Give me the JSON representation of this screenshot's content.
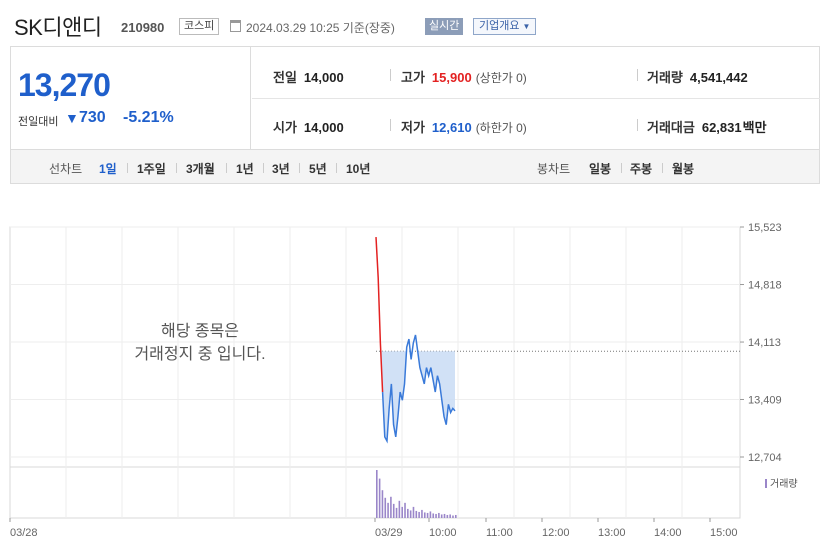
{
  "header": {
    "stock_name": "SK디앤디",
    "stock_code": "210980",
    "market": "코스피",
    "datetime": "2024.03.29 10:25 기준(장중)",
    "realtime_label": "실시간",
    "company_button": "기업개요"
  },
  "price": {
    "current": "13,270",
    "change_label": "전일대비",
    "change_arrow": "▼",
    "change_abs": "730",
    "change_pct": "-5.21%"
  },
  "stats": {
    "prev_close": {
      "label": "전일",
      "value": "14,000"
    },
    "open": {
      "label": "시가",
      "value": "14,000"
    },
    "high": {
      "label": "고가",
      "value": "15,900",
      "sub": "(상한가 0)"
    },
    "low": {
      "label": "저가",
      "value": "12,610",
      "sub": "(하한가 0)"
    },
    "volume": {
      "label": "거래량",
      "value": "4,541,442"
    },
    "trade_value": {
      "label": "거래대금",
      "value": "62,831",
      "unit": "백만"
    }
  },
  "period_bar": {
    "line_label": "선차트",
    "periods": [
      "1일",
      "1주일",
      "3개월",
      "1년",
      "3년",
      "5년",
      "10년"
    ],
    "active_period": "1일",
    "candle_label": "봉차트",
    "candles": [
      "일봉",
      "주봉",
      "월봉"
    ]
  },
  "notice": {
    "line1": "해당 종목은",
    "line2": "거래정지 중 입니다."
  },
  "colors": {
    "up": "#e32222",
    "down": "#1f5fcb",
    "price_line": "#3a7ad9",
    "area_fill": "#c9dcf5",
    "volume": "#9a86c9"
  },
  "chart_data": {
    "type": "line",
    "title": "",
    "xlabel": "",
    "ylabel": "",
    "ylim": [
      12704,
      15523
    ],
    "y_ticks": [
      "15,523",
      "14,818",
      "14,113",
      "13,409",
      "12,704"
    ],
    "y_tick_values": [
      15523,
      14818,
      14113,
      13409,
      12704
    ],
    "x_ticks": [
      "03/28",
      "03/29",
      "10:00",
      "11:00",
      "12:00",
      "13:00",
      "14:00",
      "15:00"
    ],
    "reference_price": 14000,
    "series": [
      {
        "values": [
          15400,
          14900,
          14100,
          13500,
          12950,
          12900,
          13300,
          13600,
          13100,
          12950,
          13200,
          13500,
          13400,
          13600,
          14050,
          14150,
          13900,
          14100,
          14200,
          14000,
          13800,
          13700,
          13600,
          13800,
          13700,
          13800,
          13650,
          13500,
          13700,
          13600,
          13400,
          13200,
          13100,
          13350,
          13250,
          13300,
          13270
        ]
      }
    ],
    "volume_legend": "거래량",
    "volume_values": [
      95,
      78,
      55,
      40,
      30,
      42,
      28,
      20,
      34,
      22,
      30,
      18,
      15,
      22,
      14,
      12,
      16,
      11,
      10,
      13,
      9,
      8,
      10,
      7,
      8,
      6,
      7,
      5,
      6
    ]
  }
}
